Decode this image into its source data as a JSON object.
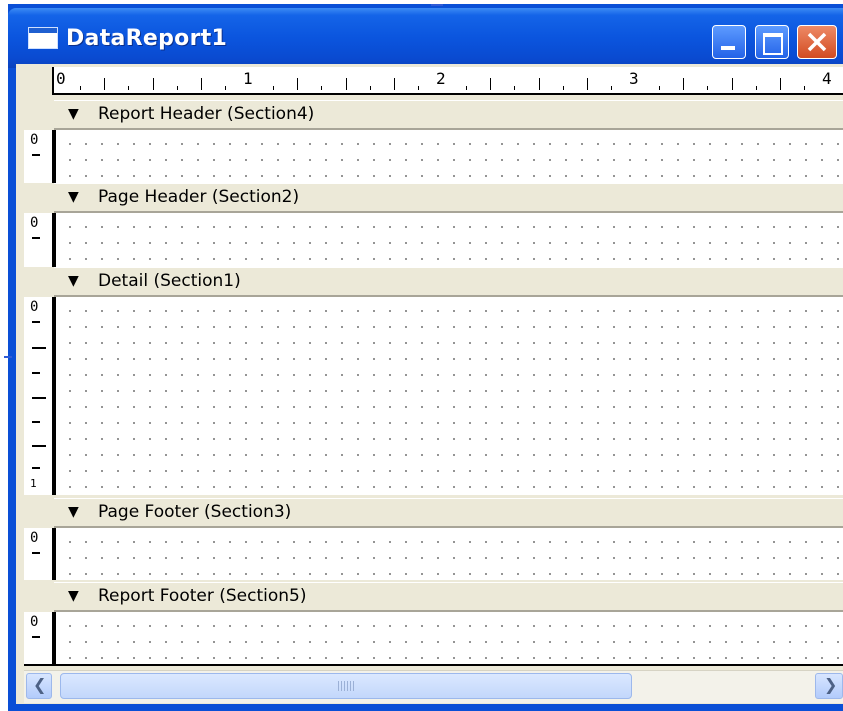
{
  "window": {
    "title": "DataReport1",
    "controls": [
      "minimize-icon",
      "maximize-icon",
      "close-icon"
    ]
  },
  "ruler": {
    "labels": [
      "0",
      "1",
      "2",
      "3",
      "4"
    ],
    "units": "inches"
  },
  "sections": [
    {
      "id": "report-header",
      "label": "Report Header (Section4)",
      "vruler": [
        "0"
      ]
    },
    {
      "id": "page-header",
      "label": "Page Header (Section2)",
      "vruler": [
        "0"
      ]
    },
    {
      "id": "detail",
      "label": "Detail (Section1)",
      "vruler": [
        "0",
        "1"
      ]
    },
    {
      "id": "page-footer",
      "label": "Page Footer (Section3)",
      "vruler": [
        "0"
      ]
    },
    {
      "id": "report-footer",
      "label": "Report Footer (Section5)",
      "vruler": [
        "0"
      ]
    }
  ],
  "icons": {
    "section_toggle": "arrow-down-icon",
    "scroll_left": "scroll-left-icon",
    "scroll_right": "scroll-right-icon"
  },
  "colors": {
    "titlebar": "#0b55de",
    "chrome": "#ece9d8",
    "close_button": "#d24b22"
  }
}
